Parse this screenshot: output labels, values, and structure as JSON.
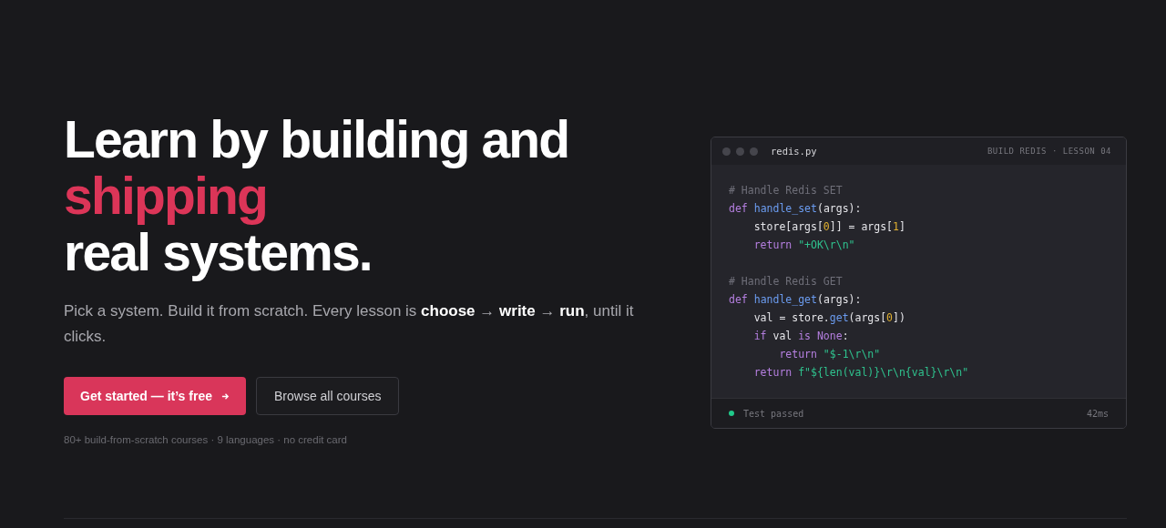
{
  "hero": {
    "headline": [
      {
        "text": "Learn by building and",
        "accent": false
      },
      {
        "text": "shipping",
        "accent": true
      },
      {
        "text": "real systems.",
        "accent": false
      }
    ],
    "subtitle": "Pick a system. Build it from scratch. Every lesson is **choose** → **write** → **run**, until it clicks.",
    "primary_button": "Get started — it’s free",
    "secondary_button": "Browse all courses",
    "footnote": "80+ build-from-scratch courses · 9 languages · no credit card"
  },
  "editor": {
    "filename": "redis.py",
    "breadcrumb": "BUILD REDIS · LESSON 04",
    "code": [
      [
        [
          {
            "kind": "comment",
            "text": "# Handle Redis SET"
          }
        ],
        [
          {
            "kind": "keyword",
            "text": "def "
          },
          {
            "kind": "function",
            "text": "handle_set"
          },
          {
            "kind": "plain",
            "text": "(args):"
          }
        ],
        [
          {
            "kind": "plain",
            "text": "    store[args["
          },
          {
            "kind": "number",
            "text": "0"
          },
          {
            "kind": "plain",
            "text": "]] = args["
          },
          {
            "kind": "number",
            "text": "1"
          },
          {
            "kind": "plain",
            "text": "]"
          }
        ],
        [
          {
            "kind": "keyword",
            "text": "    return "
          },
          {
            "kind": "string",
            "text": "\"+OK\\r\\n\""
          }
        ]
      ],
      [
        [
          {
            "kind": "comment",
            "text": "# Handle Redis GET"
          }
        ],
        [
          {
            "kind": "keyword",
            "text": "def "
          },
          {
            "kind": "function",
            "text": "handle_get"
          },
          {
            "kind": "plain",
            "text": "(args):"
          }
        ],
        [
          {
            "kind": "plain",
            "text": "    val = store."
          },
          {
            "kind": "function",
            "text": "get"
          },
          {
            "kind": "plain",
            "text": "(args["
          },
          {
            "kind": "number",
            "text": "0"
          },
          {
            "kind": "plain",
            "text": "])"
          }
        ],
        [
          {
            "kind": "keyword",
            "text": "    if "
          },
          {
            "kind": "plain",
            "text": "val "
          },
          {
            "kind": "keyword",
            "text": "is None"
          },
          {
            "kind": "plain",
            "text": ":"
          }
        ],
        [
          {
            "kind": "keyword",
            "text": "        return "
          },
          {
            "kind": "string",
            "text": "\"$-1\\r\\n\""
          }
        ],
        [
          {
            "kind": "keyword",
            "text": "    return "
          },
          {
            "kind": "string",
            "text": "f\"${len(val)}\\r\\n{val}\\r\\n\""
          }
        ]
      ]
    ],
    "status": "Test passed",
    "duration": "42ms"
  }
}
